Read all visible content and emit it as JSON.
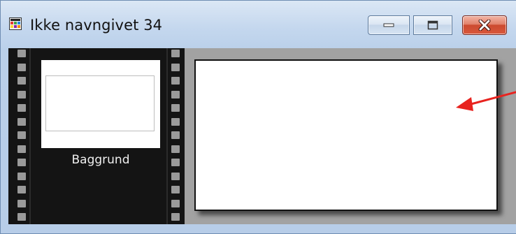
{
  "window": {
    "title": "Ikke navngivet 34",
    "app_icon": "photo-app-icon",
    "controls": {
      "minimize_icon": "minimize-icon",
      "maximize_icon": "maximize-icon",
      "close_icon": "close-icon"
    }
  },
  "layers_panel": {
    "layers": [
      {
        "label": "Baggrund"
      }
    ]
  },
  "annotation": {
    "arrow_color": "#e8231f"
  },
  "colors": {
    "close_button": "#d8573b",
    "canvas_background": "#ffffff",
    "filmstrip": "#141414"
  }
}
